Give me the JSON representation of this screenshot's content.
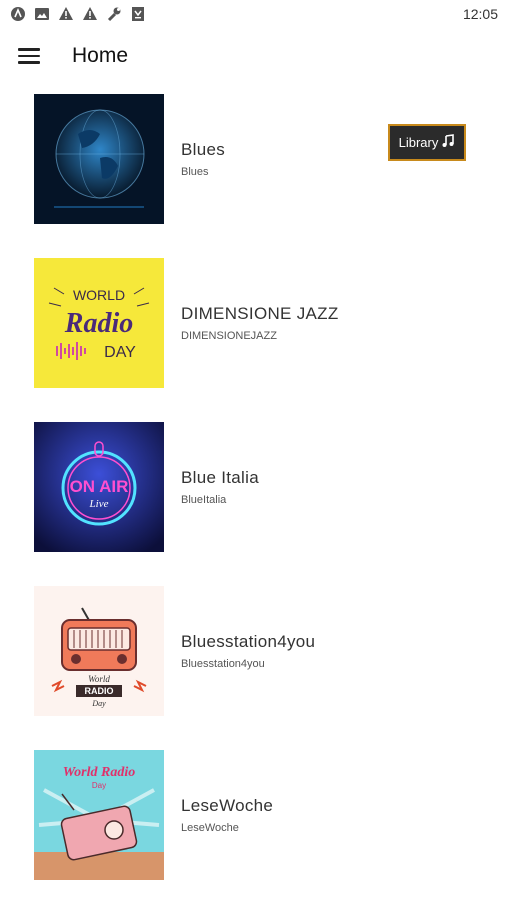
{
  "status": {
    "time": "12:05"
  },
  "header": {
    "title": "Home"
  },
  "library_button": {
    "label": "Library",
    "icon": "music-note-icon"
  },
  "stations": [
    {
      "name": "Blues",
      "subtitle": "Blues",
      "image": "globe-image"
    },
    {
      "name": "DIMENSIONE JAZZ",
      "subtitle": "DIMENSIONEJAZZ",
      "image": "world-radio-day-image",
      "image_text": [
        "WORLD",
        "Radio",
        "DAY"
      ]
    },
    {
      "name": "Blue Italia",
      "subtitle": "BlueItalia",
      "image": "on-air-neon-image",
      "image_text": [
        "ON AIR",
        "Live"
      ]
    },
    {
      "name": "Bluesstation4you",
      "subtitle": "Bluesstation4you",
      "image": "retro-radio-image",
      "image_text": [
        "World",
        "RADIO",
        "Day"
      ]
    },
    {
      "name": "LeseWoche",
      "subtitle": "LeseWoche",
      "image": "vintage-radio-image",
      "image_text": [
        "World Radio",
        "Day"
      ]
    }
  ]
}
